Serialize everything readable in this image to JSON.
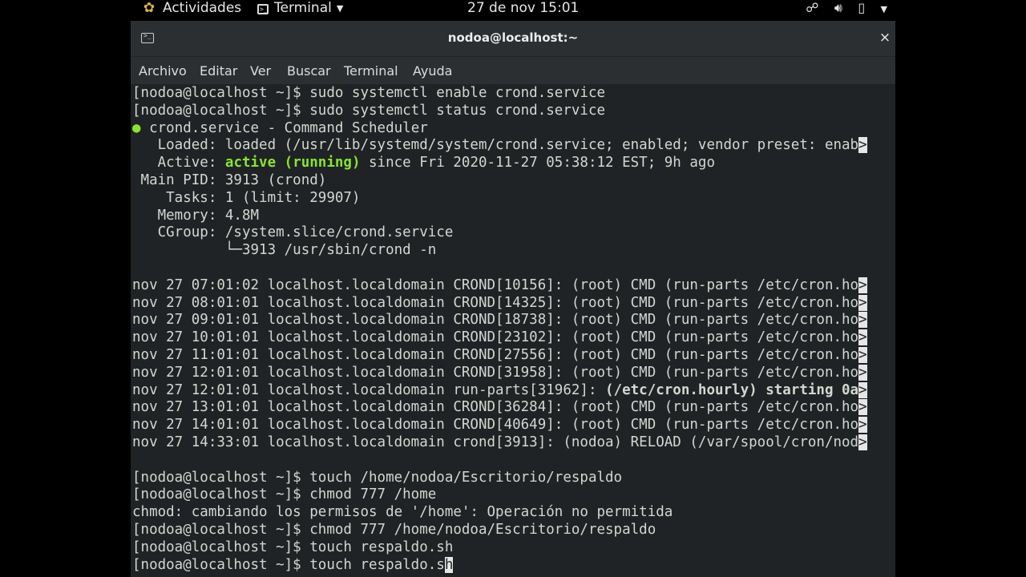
{
  "topbar": {
    "activities": "Actividades",
    "app_menu": "Terminal",
    "clock": "27 de nov  15:01"
  },
  "window": {
    "title": "nodoa@localhost:~",
    "close": "×",
    "menus": [
      "Archivo",
      "Editar",
      "Ver",
      "Buscar",
      "Terminal",
      "Ayuda"
    ]
  },
  "terminal": {
    "l01": "[nodoa@localhost ~]$ sudo systemctl enable crond.service",
    "l02": "[nodoa@localhost ~]$ sudo systemctl status crond.service",
    "l03_dot": "●",
    "l03": " crond.service - Command Scheduler",
    "l04": "   Loaded: loaded (/usr/lib/systemd/system/crond.service; enabled; vendor preset: enab",
    "l05_a": "   Active: ",
    "l05_b": "active (running)",
    "l05_c": " since Fri 2020-11-27 05:38:12 EST; 9h ago",
    "l06": " Main PID: 3913 (crond)",
    "l07": "    Tasks: 1 (limit: 29907)",
    "l08": "   Memory: 4.8M",
    "l09": "   CGroup: /system.slice/crond.service",
    "l10": "           └─3913 /usr/sbin/crond -n",
    "l11": "",
    "l12": "nov 27 07:01:02 localhost.localdomain CROND[10156]: (root) CMD (run-parts /etc/cron.ho",
    "l13": "nov 27 08:01:01 localhost.localdomain CROND[14325]: (root) CMD (run-parts /etc/cron.ho",
    "l14": "nov 27 09:01:01 localhost.localdomain CROND[18738]: (root) CMD (run-parts /etc/cron.ho",
    "l15": "nov 27 10:01:01 localhost.localdomain CROND[23102]: (root) CMD (run-parts /etc/cron.ho",
    "l16": "nov 27 11:01:01 localhost.localdomain CROND[27556]: (root) CMD (run-parts /etc/cron.ho",
    "l17": "nov 27 12:01:01 localhost.localdomain CROND[31958]: (root) CMD (run-parts /etc/cron.ho",
    "l18_a": "nov 27 12:01:01 localhost.localdomain run-parts[31962]: ",
    "l18_b": "(/etc/cron.hourly) starting 0a",
    "l19": "nov 27 13:01:01 localhost.localdomain CROND[36284]: (root) CMD (run-parts /etc/cron.ho",
    "l20": "nov 27 14:01:01 localhost.localdomain CROND[40649]: (root) CMD (run-parts /etc/cron.ho",
    "l21": "nov 27 14:33:01 localhost.localdomain crond[3913]: (nodoa) RELOAD (/var/spool/cron/nod",
    "l22": "",
    "l23": "[nodoa@localhost ~]$ touch /home/nodoa/Escritorio/respaldo",
    "l24": "[nodoa@localhost ~]$ chmod 777 /home",
    "l25": "chmod: cambiando los permisos de '/home': Operación no permitida",
    "l26": "[nodoa@localhost ~]$ chmod 777 /home/nodoa/Escritorio/respaldo",
    "l27": "[nodoa@localhost ~]$ touch respaldo.sh",
    "l28_a": "[nodoa@localhost ~]$ touch respaldo.s",
    "l28_cursor": "h",
    "trunc_marker": ">"
  },
  "icons": {
    "activities": "gnome-foot-icon",
    "app_menu": "terminal-icon",
    "network": "network-icon",
    "volume": "volume-icon",
    "battery": "battery-icon",
    "system": "chevron-down-icon"
  },
  "colors": {
    "terminal_bg": "#1f2325",
    "terminal_fg": "#d3d7cf",
    "accent_green": "#8ae234",
    "titlebar": "#2b2f31"
  }
}
